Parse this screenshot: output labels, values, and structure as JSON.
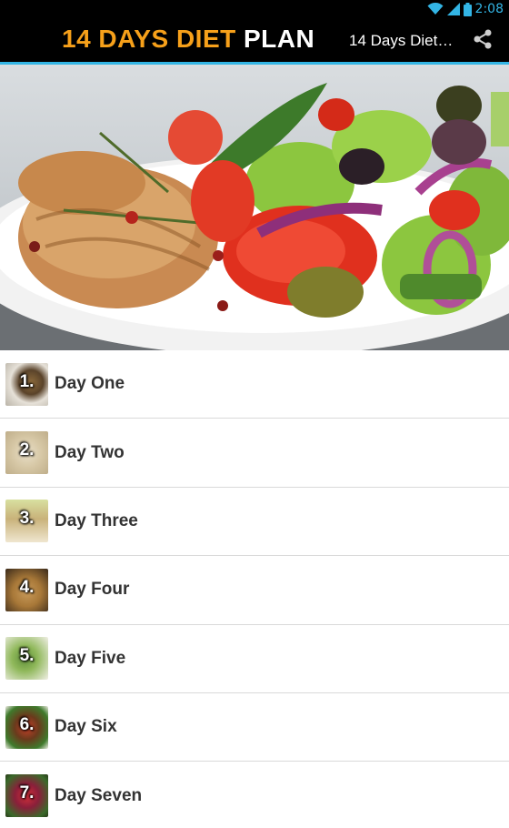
{
  "status_bar": {
    "time": "2:08",
    "icons": [
      "wifi-icon",
      "signal-icon",
      "battery-icon"
    ]
  },
  "action_bar": {
    "logo": {
      "part1": "14 DAYS ",
      "part2": "DIET",
      "part3": " PLAN"
    },
    "title": "14 Days Diet…",
    "share_icon": "share-icon"
  },
  "hero": {
    "image": "grilled chicken breast with salad on white plate"
  },
  "days": [
    {
      "number": "1.",
      "label": "Day One"
    },
    {
      "number": "2.",
      "label": "Day Two"
    },
    {
      "number": "3.",
      "label": "Day Three"
    },
    {
      "number": "4.",
      "label": "Day Four"
    },
    {
      "number": "5.",
      "label": "Day Five"
    },
    {
      "number": "6.",
      "label": "Day Six"
    },
    {
      "number": "7.",
      "label": "Day Seven"
    }
  ],
  "colors": {
    "accent": "#33b5e5",
    "logo_orange": "#f6a01a",
    "bar": "#000000",
    "text": "#333333"
  }
}
